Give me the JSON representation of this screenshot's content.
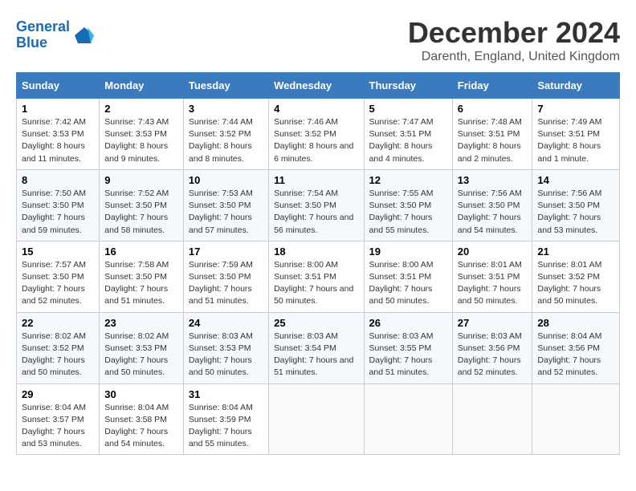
{
  "header": {
    "logo_line1": "General",
    "logo_line2": "Blue",
    "title": "December 2024",
    "subtitle": "Darenth, England, United Kingdom"
  },
  "columns": [
    "Sunday",
    "Monday",
    "Tuesday",
    "Wednesday",
    "Thursday",
    "Friday",
    "Saturday"
  ],
  "weeks": [
    [
      {
        "day": "1",
        "info": "Sunrise: 7:42 AM\nSunset: 3:53 PM\nDaylight: 8 hours and 11 minutes."
      },
      {
        "day": "2",
        "info": "Sunrise: 7:43 AM\nSunset: 3:53 PM\nDaylight: 8 hours and 9 minutes."
      },
      {
        "day": "3",
        "info": "Sunrise: 7:44 AM\nSunset: 3:52 PM\nDaylight: 8 hours and 8 minutes."
      },
      {
        "day": "4",
        "info": "Sunrise: 7:46 AM\nSunset: 3:52 PM\nDaylight: 8 hours and 6 minutes."
      },
      {
        "day": "5",
        "info": "Sunrise: 7:47 AM\nSunset: 3:51 PM\nDaylight: 8 hours and 4 minutes."
      },
      {
        "day": "6",
        "info": "Sunrise: 7:48 AM\nSunset: 3:51 PM\nDaylight: 8 hours and 2 minutes."
      },
      {
        "day": "7",
        "info": "Sunrise: 7:49 AM\nSunset: 3:51 PM\nDaylight: 8 hours and 1 minute."
      }
    ],
    [
      {
        "day": "8",
        "info": "Sunrise: 7:50 AM\nSunset: 3:50 PM\nDaylight: 7 hours and 59 minutes."
      },
      {
        "day": "9",
        "info": "Sunrise: 7:52 AM\nSunset: 3:50 PM\nDaylight: 7 hours and 58 minutes."
      },
      {
        "day": "10",
        "info": "Sunrise: 7:53 AM\nSunset: 3:50 PM\nDaylight: 7 hours and 57 minutes."
      },
      {
        "day": "11",
        "info": "Sunrise: 7:54 AM\nSunset: 3:50 PM\nDaylight: 7 hours and 56 minutes."
      },
      {
        "day": "12",
        "info": "Sunrise: 7:55 AM\nSunset: 3:50 PM\nDaylight: 7 hours and 55 minutes."
      },
      {
        "day": "13",
        "info": "Sunrise: 7:56 AM\nSunset: 3:50 PM\nDaylight: 7 hours and 54 minutes."
      },
      {
        "day": "14",
        "info": "Sunrise: 7:56 AM\nSunset: 3:50 PM\nDaylight: 7 hours and 53 minutes."
      }
    ],
    [
      {
        "day": "15",
        "info": "Sunrise: 7:57 AM\nSunset: 3:50 PM\nDaylight: 7 hours and 52 minutes."
      },
      {
        "day": "16",
        "info": "Sunrise: 7:58 AM\nSunset: 3:50 PM\nDaylight: 7 hours and 51 minutes."
      },
      {
        "day": "17",
        "info": "Sunrise: 7:59 AM\nSunset: 3:50 PM\nDaylight: 7 hours and 51 minutes."
      },
      {
        "day": "18",
        "info": "Sunrise: 8:00 AM\nSunset: 3:51 PM\nDaylight: 7 hours and 50 minutes."
      },
      {
        "day": "19",
        "info": "Sunrise: 8:00 AM\nSunset: 3:51 PM\nDaylight: 7 hours and 50 minutes."
      },
      {
        "day": "20",
        "info": "Sunrise: 8:01 AM\nSunset: 3:51 PM\nDaylight: 7 hours and 50 minutes."
      },
      {
        "day": "21",
        "info": "Sunrise: 8:01 AM\nSunset: 3:52 PM\nDaylight: 7 hours and 50 minutes."
      }
    ],
    [
      {
        "day": "22",
        "info": "Sunrise: 8:02 AM\nSunset: 3:52 PM\nDaylight: 7 hours and 50 minutes."
      },
      {
        "day": "23",
        "info": "Sunrise: 8:02 AM\nSunset: 3:53 PM\nDaylight: 7 hours and 50 minutes."
      },
      {
        "day": "24",
        "info": "Sunrise: 8:03 AM\nSunset: 3:53 PM\nDaylight: 7 hours and 50 minutes."
      },
      {
        "day": "25",
        "info": "Sunrise: 8:03 AM\nSunset: 3:54 PM\nDaylight: 7 hours and 51 minutes."
      },
      {
        "day": "26",
        "info": "Sunrise: 8:03 AM\nSunset: 3:55 PM\nDaylight: 7 hours and 51 minutes."
      },
      {
        "day": "27",
        "info": "Sunrise: 8:03 AM\nSunset: 3:56 PM\nDaylight: 7 hours and 52 minutes."
      },
      {
        "day": "28",
        "info": "Sunrise: 8:04 AM\nSunset: 3:56 PM\nDaylight: 7 hours and 52 minutes."
      }
    ],
    [
      {
        "day": "29",
        "info": "Sunrise: 8:04 AM\nSunset: 3:57 PM\nDaylight: 7 hours and 53 minutes."
      },
      {
        "day": "30",
        "info": "Sunrise: 8:04 AM\nSunset: 3:58 PM\nDaylight: 7 hours and 54 minutes."
      },
      {
        "day": "31",
        "info": "Sunrise: 8:04 AM\nSunset: 3:59 PM\nDaylight: 7 hours and 55 minutes."
      },
      null,
      null,
      null,
      null
    ]
  ]
}
